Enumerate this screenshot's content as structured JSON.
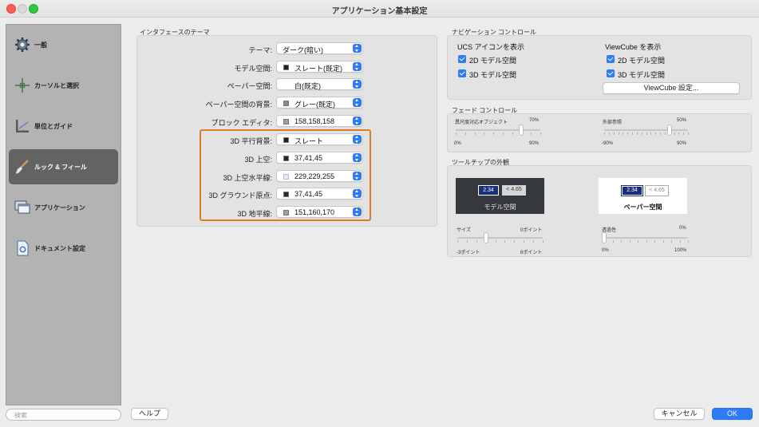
{
  "window": {
    "title": "アプリケーション基本設定"
  },
  "sidebar": {
    "items": [
      {
        "label": "一般",
        "icon": "gear-icon"
      },
      {
        "label": "カーソルと選択",
        "icon": "crosshair-cursor-icon"
      },
      {
        "label": "単位とガイド",
        "icon": "ruler-guide-icon"
      },
      {
        "label": "ルック & フィール",
        "icon": "paintbrush-icon",
        "active": true
      },
      {
        "label": "アプリケーション",
        "icon": "windows-icon"
      },
      {
        "label": "ドキュメント設定",
        "icon": "document-settings-icon"
      }
    ],
    "search_placeholder": "検索"
  },
  "interface_theme": {
    "title": "インタフェースのテーマ",
    "rows": [
      {
        "label": "テーマ:",
        "value": "ダーク(暗い)",
        "swatch": null
      },
      {
        "label": "モデル空間:",
        "value": "スレート(既定)",
        "swatch": "#1e1f22"
      },
      {
        "label": "ペーパー空間:",
        "value": "白(既定)",
        "swatch": null
      },
      {
        "label": "ペーパー空間の背景:",
        "value": "グレー(既定)",
        "swatch": "#8a8a8a"
      },
      {
        "label": "ブロック エディタ:",
        "value": "158,158,158",
        "swatch": "#9e9e9e"
      },
      {
        "label": "3D 平行背景:",
        "value": "スレート",
        "swatch": "#1e1f22"
      },
      {
        "label": "3D 上空:",
        "value": "37,41,45",
        "swatch": "#25292d"
      },
      {
        "label": "3D 上空水平線:",
        "value": "229,229,255",
        "swatch": "#e5e5ff"
      },
      {
        "label": "3D グラウンド原点:",
        "value": "37,41,45",
        "swatch": "#25292d"
      },
      {
        "label": "3D 地平線:",
        "value": "151,160,170",
        "swatch": "#97a0aa"
      }
    ]
  },
  "navigation": {
    "title": "ナビゲーション コントロール",
    "ucs": {
      "heading": "UCS アイコンを表示",
      "opt_2d": "2D モデル空間",
      "opt_3d": "3D モデル空間"
    },
    "viewcube": {
      "heading": "ViewCube を表示",
      "opt_2d": "2D モデル空間",
      "opt_3d": "3D モデル空間",
      "button": "ViewCube 設定..."
    }
  },
  "fade": {
    "title": "フェード コントロール",
    "xref_objects": {
      "label": "異尺度対応オブジェクト",
      "value": "70%",
      "min": "0%",
      "max": "90%",
      "level_percent": 70
    },
    "external_ref": {
      "label": "外部参照",
      "value": "50%",
      "min": "-90%",
      "max": "90%",
      "level_percent": 50
    }
  },
  "tooltip": {
    "title": "ツールチップの外観",
    "sample_value": "2.34",
    "sample_compare": "< 4.65",
    "model_caption": "モデル空間",
    "paper_caption": "ペーパー空間",
    "size": {
      "label": "サイズ",
      "value": "0ポイント",
      "min": "-3ポイント",
      "max": "6ポイント",
      "level": 0
    },
    "transparency": {
      "label": "透過性",
      "value": "0%",
      "min": "0%",
      "max": "100%",
      "level_percent": 0
    }
  },
  "footer": {
    "help": "ヘルプ",
    "cancel": "キャンセル",
    "ok": "OK"
  },
  "colors": {
    "accent": "#2b7cf6",
    "highlight_border": "#e07b23",
    "sidebar_active": "#636363"
  }
}
